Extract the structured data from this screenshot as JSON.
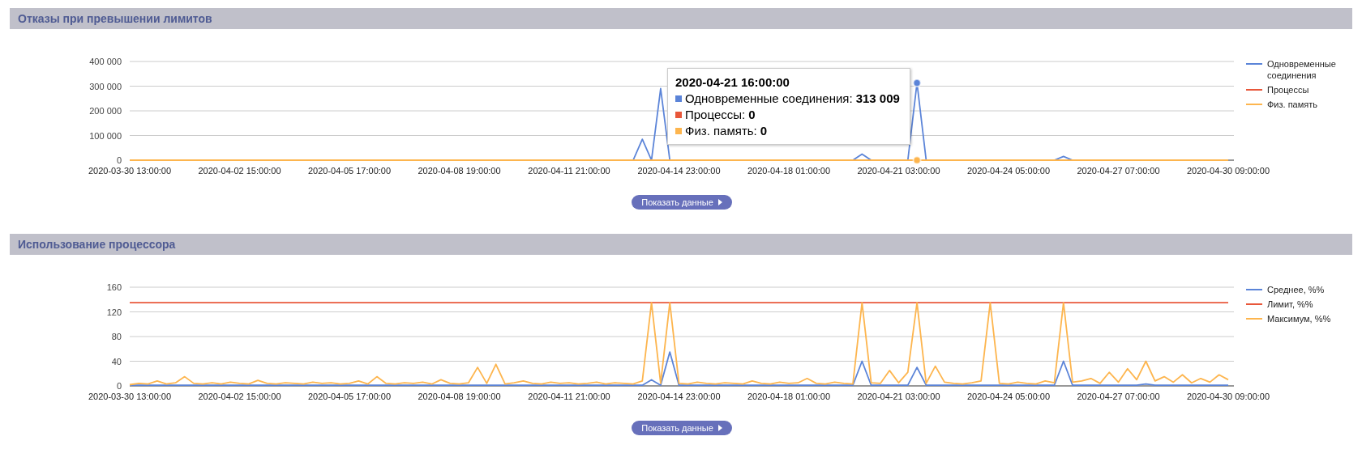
{
  "sections": [
    {
      "title": "Отказы при превышении лимитов",
      "chart_data": {
        "type": "line",
        "categories": [
          "2020-03-30 13:00:00",
          null,
          null,
          null,
          null,
          null,
          null,
          null,
          null,
          null,
          null,
          null,
          "2020-04-02 15:00:00",
          null,
          null,
          null,
          null,
          null,
          null,
          null,
          null,
          null,
          null,
          null,
          "2020-04-05 17:00:00",
          null,
          null,
          null,
          null,
          null,
          null,
          null,
          null,
          null,
          null,
          null,
          "2020-04-08 19:00:00",
          null,
          null,
          null,
          null,
          null,
          null,
          null,
          null,
          null,
          null,
          null,
          "2020-04-11 21:00:00",
          null,
          null,
          null,
          null,
          null,
          null,
          null,
          null,
          null,
          null,
          null,
          "2020-04-14 23:00:00",
          null,
          null,
          null,
          null,
          null,
          null,
          null,
          null,
          null,
          null,
          null,
          "2020-04-18 01:00:00",
          null,
          null,
          null,
          null,
          null,
          null,
          null,
          null,
          null,
          null,
          null,
          "2020-04-21 03:00:00",
          null,
          null,
          null,
          null,
          null,
          null,
          null,
          null,
          null,
          null,
          null,
          "2020-04-24 05:00:00",
          null,
          null,
          null,
          null,
          null,
          null,
          null,
          null,
          null,
          null,
          null,
          "2020-04-27 07:00:00",
          null,
          null,
          null,
          null,
          null,
          null,
          null,
          null,
          null,
          null,
          null,
          "2020-04-30 09:00:00"
        ],
        "series": [
          {
            "name": "Одновременные соединения",
            "color": "#5b84d8",
            "values": [
              null,
              null,
              null,
              null,
              null,
              null,
              null,
              null,
              null,
              null,
              null,
              null,
              null,
              null,
              null,
              null,
              null,
              null,
              null,
              null,
              null,
              null,
              null,
              null,
              null,
              null,
              null,
              null,
              null,
              null,
              null,
              null,
              null,
              null,
              null,
              null,
              null,
              null,
              null,
              null,
              null,
              null,
              null,
              null,
              null,
              null,
              null,
              null,
              null,
              null,
              null,
              null,
              null,
              null,
              null,
              0,
              85000,
              0,
              290000,
              0,
              null,
              null,
              null,
              null,
              null,
              null,
              null,
              null,
              null,
              null,
              null,
              null,
              null,
              null,
              null,
              null,
              null,
              null,
              null,
              0,
              25000,
              0,
              null,
              null,
              null,
              0,
              313009,
              0,
              null,
              null,
              null,
              null,
              null,
              null,
              null,
              null,
              null,
              null,
              null,
              null,
              null,
              0,
              15000,
              0,
              null,
              null,
              null,
              null,
              null,
              null,
              null,
              null,
              null,
              null,
              null,
              null,
              null,
              null,
              null,
              null,
              null
            ]
          },
          {
            "name": "Процессы",
            "color": "#e8573a",
            "values": [
              null,
              null,
              null,
              null,
              null,
              null,
              null,
              null,
              null,
              null,
              null,
              null,
              null,
              null,
              null,
              null,
              null,
              null,
              null,
              null,
              null,
              null,
              null,
              null,
              null,
              null,
              null,
              null,
              null,
              null,
              null,
              null,
              null,
              null,
              null,
              null,
              null,
              null,
              null,
              null,
              null,
              null,
              null,
              null,
              null,
              null,
              null,
              null,
              null,
              null,
              null,
              null,
              null,
              null,
              null,
              null,
              null,
              null,
              null,
              null,
              null,
              null,
              null,
              null,
              null,
              null,
              null,
              null,
              null,
              null,
              null,
              null,
              null,
              null,
              null,
              null,
              null,
              null,
              null,
              null,
              null,
              null,
              null,
              null,
              null,
              null,
              null,
              null,
              null,
              null,
              null,
              null,
              null,
              null,
              null,
              null,
              null,
              null,
              null,
              null,
              null,
              null,
              null,
              null,
              null,
              null,
              null,
              null,
              null,
              null,
              null,
              null,
              null,
              null,
              null,
              null,
              null,
              null,
              null,
              null,
              null
            ]
          },
          {
            "name": "Физ. память",
            "color": "#fdb54e",
            "values": [
              0,
              0,
              0,
              0,
              0,
              0,
              0,
              0,
              0,
              0,
              0,
              0,
              0,
              0,
              0,
              0,
              0,
              0,
              0,
              0,
              0,
              0,
              0,
              0,
              0,
              0,
              0,
              0,
              0,
              0,
              0,
              0,
              0,
              0,
              0,
              0,
              0,
              0,
              0,
              0,
              0,
              0,
              0,
              0,
              0,
              0,
              0,
              0,
              0,
              0,
              0,
              0,
              0,
              0,
              0,
              0,
              0,
              0,
              0,
              0,
              0,
              0,
              0,
              0,
              0,
              0,
              0,
              0,
              0,
              0,
              0,
              0,
              0,
              0,
              0,
              0,
              0,
              0,
              0,
              0,
              0,
              0,
              0,
              0,
              0,
              0,
              0,
              0,
              0,
              0,
              0,
              0,
              0,
              0,
              0,
              0,
              0,
              0,
              0,
              0,
              0,
              0,
              0,
              0,
              0,
              0,
              0,
              0,
              0,
              0,
              0,
              0,
              0,
              0,
              0,
              0,
              0,
              0,
              0,
              0,
              0
            ]
          }
        ],
        "ylim": [
          0,
          400000
        ],
        "grid": true,
        "legend": true,
        "yticks": [
          {
            "value": 0,
            "label": "0"
          },
          {
            "value": 100000,
            "label": "100 000"
          },
          {
            "value": 200000,
            "label": "200 000"
          },
          {
            "value": 300000,
            "label": "300 000"
          },
          {
            "value": 400000,
            "label": "400 000"
          }
        ]
      },
      "tooltip": {
        "title": "2020-04-21 16:00:00",
        "rows": [
          {
            "label": "Одновременные соединения:",
            "value": "313 009",
            "color": "#5b84d8"
          },
          {
            "label": "Процессы:",
            "value": "0",
            "color": "#e8573a"
          },
          {
            "label": "Физ. память:",
            "value": "0",
            "color": "#fdb54e"
          }
        ]
      },
      "button": "Показать данные"
    },
    {
      "title": "Использование процессора",
      "chart_data": {
        "type": "line",
        "categories": [
          "2020-03-30 13:00:00",
          null,
          null,
          null,
          null,
          null,
          null,
          null,
          null,
          null,
          null,
          null,
          "2020-04-02 15:00:00",
          null,
          null,
          null,
          null,
          null,
          null,
          null,
          null,
          null,
          null,
          null,
          "2020-04-05 17:00:00",
          null,
          null,
          null,
          null,
          null,
          null,
          null,
          null,
          null,
          null,
          null,
          "2020-04-08 19:00:00",
          null,
          null,
          null,
          null,
          null,
          null,
          null,
          null,
          null,
          null,
          null,
          "2020-04-11 21:00:00",
          null,
          null,
          null,
          null,
          null,
          null,
          null,
          null,
          null,
          null,
          null,
          "2020-04-14 23:00:00",
          null,
          null,
          null,
          null,
          null,
          null,
          null,
          null,
          null,
          null,
          null,
          "2020-04-18 01:00:00",
          null,
          null,
          null,
          null,
          null,
          null,
          null,
          null,
          null,
          null,
          null,
          "2020-04-21 03:00:00",
          null,
          null,
          null,
          null,
          null,
          null,
          null,
          null,
          null,
          null,
          null,
          "2020-04-24 05:00:00",
          null,
          null,
          null,
          null,
          null,
          null,
          null,
          null,
          null,
          null,
          null,
          "2020-04-27 07:00:00",
          null,
          null,
          null,
          null,
          null,
          null,
          null,
          null,
          null,
          null,
          null,
          "2020-04-30 09:00:00"
        ],
        "series": [
          {
            "name": "Среднее, %%",
            "color": "#5b84d8",
            "values": [
              1,
              1,
              1,
              1,
              1,
              1,
              1,
              1,
              1,
              1,
              1,
              1,
              1,
              1,
              1,
              1,
              1,
              1,
              1,
              1,
              1,
              1,
              1,
              1,
              1,
              1,
              1,
              1,
              1,
              1,
              1,
              1,
              1,
              1,
              1,
              1,
              1,
              1,
              1,
              1,
              1,
              1,
              1,
              1,
              1,
              1,
              1,
              1,
              1,
              1,
              1,
              1,
              1,
              1,
              1,
              1,
              1,
              10,
              1,
              55,
              1,
              1,
              1,
              1,
              1,
              1,
              1,
              1,
              1,
              1,
              1,
              1,
              1,
              1,
              1,
              1,
              1,
              1,
              1,
              1,
              40,
              1,
              1,
              1,
              1,
              1,
              30,
              1,
              1,
              1,
              1,
              1,
              1,
              1,
              1,
              1,
              1,
              1,
              1,
              1,
              1,
              1,
              40,
              1,
              1,
              1,
              1,
              1,
              1,
              1,
              1,
              3,
              1,
              1,
              1,
              1,
              1,
              1,
              1,
              1,
              1
            ]
          },
          {
            "name": "Лимит, %%",
            "color": "#e8573a",
            "values": [
              135,
              135,
              135,
              135,
              135,
              135,
              135,
              135,
              135,
              135,
              135,
              135,
              135,
              135,
              135,
              135,
              135,
              135,
              135,
              135,
              135,
              135,
              135,
              135,
              135,
              135,
              135,
              135,
              135,
              135,
              135,
              135,
              135,
              135,
              135,
              135,
              135,
              135,
              135,
              135,
              135,
              135,
              135,
              135,
              135,
              135,
              135,
              135,
              135,
              135,
              135,
              135,
              135,
              135,
              135,
              135,
              135,
              135,
              135,
              135,
              135,
              135,
              135,
              135,
              135,
              135,
              135,
              135,
              135,
              135,
              135,
              135,
              135,
              135,
              135,
              135,
              135,
              135,
              135,
              135,
              135,
              135,
              135,
              135,
              135,
              135,
              135,
              135,
              135,
              135,
              135,
              135,
              135,
              135,
              135,
              135,
              135,
              135,
              135,
              135,
              135,
              135,
              135,
              135,
              135,
              135,
              135,
              135,
              135,
              135,
              135,
              135,
              135,
              135,
              135,
              135,
              135,
              135,
              135,
              135,
              135
            ]
          },
          {
            "name": "Максимум, %%",
            "color": "#fdb54e",
            "values": [
              2,
              4,
              3,
              8,
              3,
              5,
              15,
              4,
              3,
              5,
              3,
              6,
              4,
              3,
              9,
              4,
              3,
              5,
              4,
              3,
              6,
              4,
              5,
              3,
              4,
              8,
              3,
              15,
              4,
              3,
              5,
              4,
              6,
              3,
              10,
              4,
              3,
              5,
              30,
              4,
              35,
              3,
              5,
              8,
              4,
              3,
              6,
              4,
              5,
              3,
              4,
              6,
              3,
              5,
              4,
              3,
              8,
              135,
              4,
              135,
              4,
              3,
              6,
              4,
              3,
              5,
              4,
              3,
              8,
              4,
              3,
              6,
              4,
              5,
              12,
              4,
              3,
              6,
              4,
              3,
              135,
              5,
              4,
              25,
              5,
              22,
              135,
              4,
              32,
              6,
              4,
              3,
              5,
              8,
              135,
              4,
              3,
              6,
              4,
              3,
              8,
              5,
              135,
              6,
              8,
              12,
              4,
              22,
              6,
              28,
              10,
              40,
              8,
              15,
              6,
              18,
              5,
              12,
              6,
              18,
              10
            ]
          }
        ],
        "ylim": [
          0,
          160
        ],
        "grid": true,
        "legend": true,
        "yticks": [
          0,
          40,
          80,
          120,
          160
        ]
      },
      "button": "Показать данные"
    }
  ]
}
